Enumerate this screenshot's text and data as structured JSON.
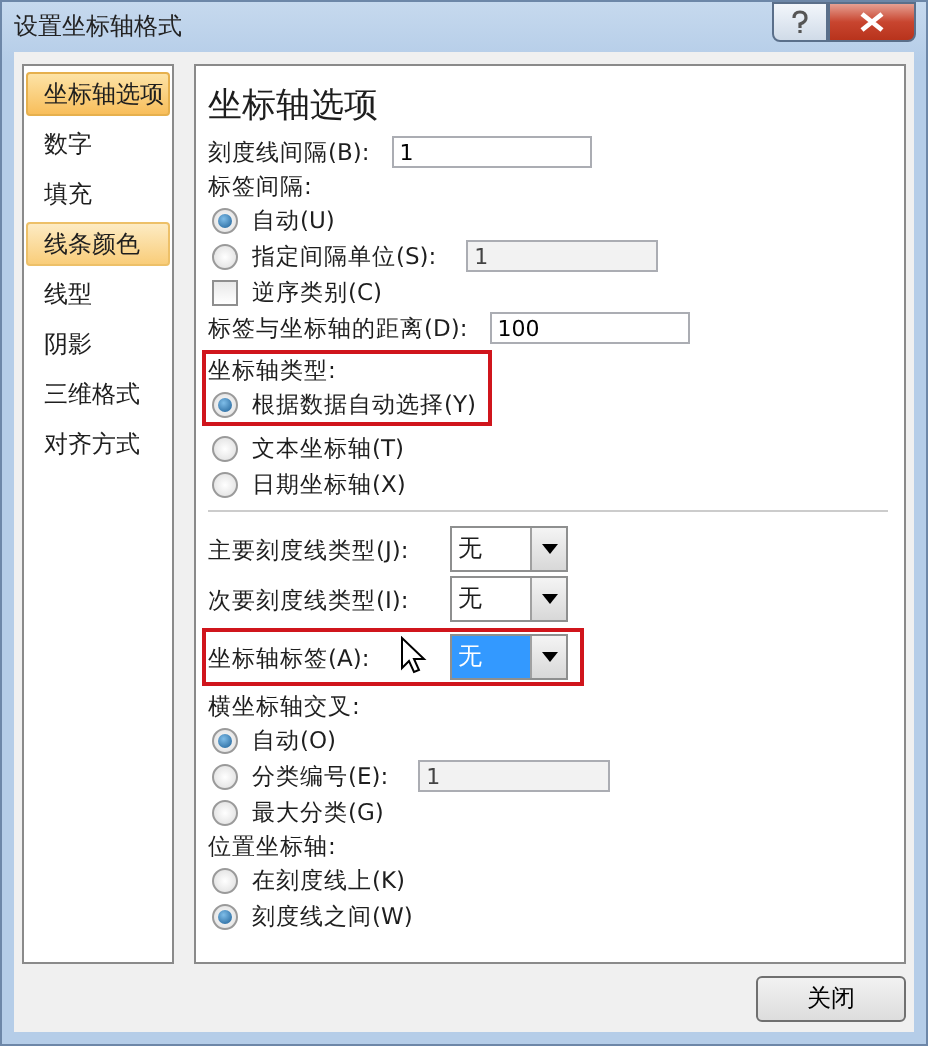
{
  "window": {
    "title": "设置坐标轴格式"
  },
  "sidebar": {
    "items": [
      {
        "label": "坐标轴选项",
        "selected": true,
        "hovered": false
      },
      {
        "label": "数字",
        "selected": false,
        "hovered": false
      },
      {
        "label": "填充",
        "selected": false,
        "hovered": false
      },
      {
        "label": "线条颜色",
        "selected": false,
        "hovered": true
      },
      {
        "label": "线型",
        "selected": false,
        "hovered": false
      },
      {
        "label": "阴影",
        "selected": false,
        "hovered": false
      },
      {
        "label": "三维格式",
        "selected": false,
        "hovered": false
      },
      {
        "label": "对齐方式",
        "selected": false,
        "hovered": false
      }
    ]
  },
  "panel": {
    "sections": [
      {
        "highlighted": false,
        "items": [
          {
            "kind": "heading",
            "label": "坐标轴选项"
          },
          {
            "kind": "field",
            "label": "刻度线间隔(B):",
            "value": "1",
            "disabled": false
          },
          {
            "kind": "label",
            "label": "标签间隔:"
          },
          {
            "kind": "radio",
            "label": "自动(U)",
            "selected": true
          },
          {
            "kind": "radio",
            "label": "指定间隔单位(S):",
            "selected": false,
            "value": "1",
            "disabled": true
          },
          {
            "kind": "checkbox",
            "label": "逆序类别(C)",
            "checked": false
          },
          {
            "kind": "field",
            "label": "标签与坐标轴的距离(D):",
            "value": "100",
            "disabled": false
          }
        ]
      },
      {
        "highlighted": true,
        "items": [
          {
            "kind": "label",
            "label": "坐标轴类型:"
          },
          {
            "kind": "radio",
            "label": "根据数据自动选择(Y)",
            "selected": true
          }
        ]
      },
      {
        "highlighted": false,
        "items": [
          {
            "kind": "radio",
            "label": "文本坐标轴(T)",
            "selected": false
          },
          {
            "kind": "radio",
            "label": "日期坐标轴(X)",
            "selected": false
          },
          {
            "kind": "separator"
          },
          {
            "kind": "select",
            "label": "主要刻度线类型(J):",
            "value": "无",
            "focused": false
          },
          {
            "kind": "select",
            "label": "次要刻度线类型(I):",
            "value": "无",
            "focused": false
          }
        ]
      },
      {
        "highlighted": true,
        "items": [
          {
            "kind": "select",
            "label": "坐标轴标签(A):",
            "value": "无",
            "focused": true
          }
        ]
      },
      {
        "highlighted": false,
        "items": [
          {
            "kind": "label",
            "label": "横坐标轴交叉:"
          },
          {
            "kind": "radio",
            "label": "自动(O)",
            "selected": true
          },
          {
            "kind": "radio",
            "label": "分类编号(E):",
            "selected": false,
            "value": "1",
            "disabled": true
          },
          {
            "kind": "radio",
            "label": "最大分类(G)",
            "selected": false
          },
          {
            "kind": "label",
            "label": "位置坐标轴:"
          },
          {
            "kind": "radio",
            "label": "在刻度线上(K)",
            "selected": false
          },
          {
            "kind": "radio",
            "label": "刻度线之间(W)",
            "selected": true
          }
        ]
      }
    ]
  },
  "buttons": [
    {
      "label": "关闭"
    }
  ]
}
